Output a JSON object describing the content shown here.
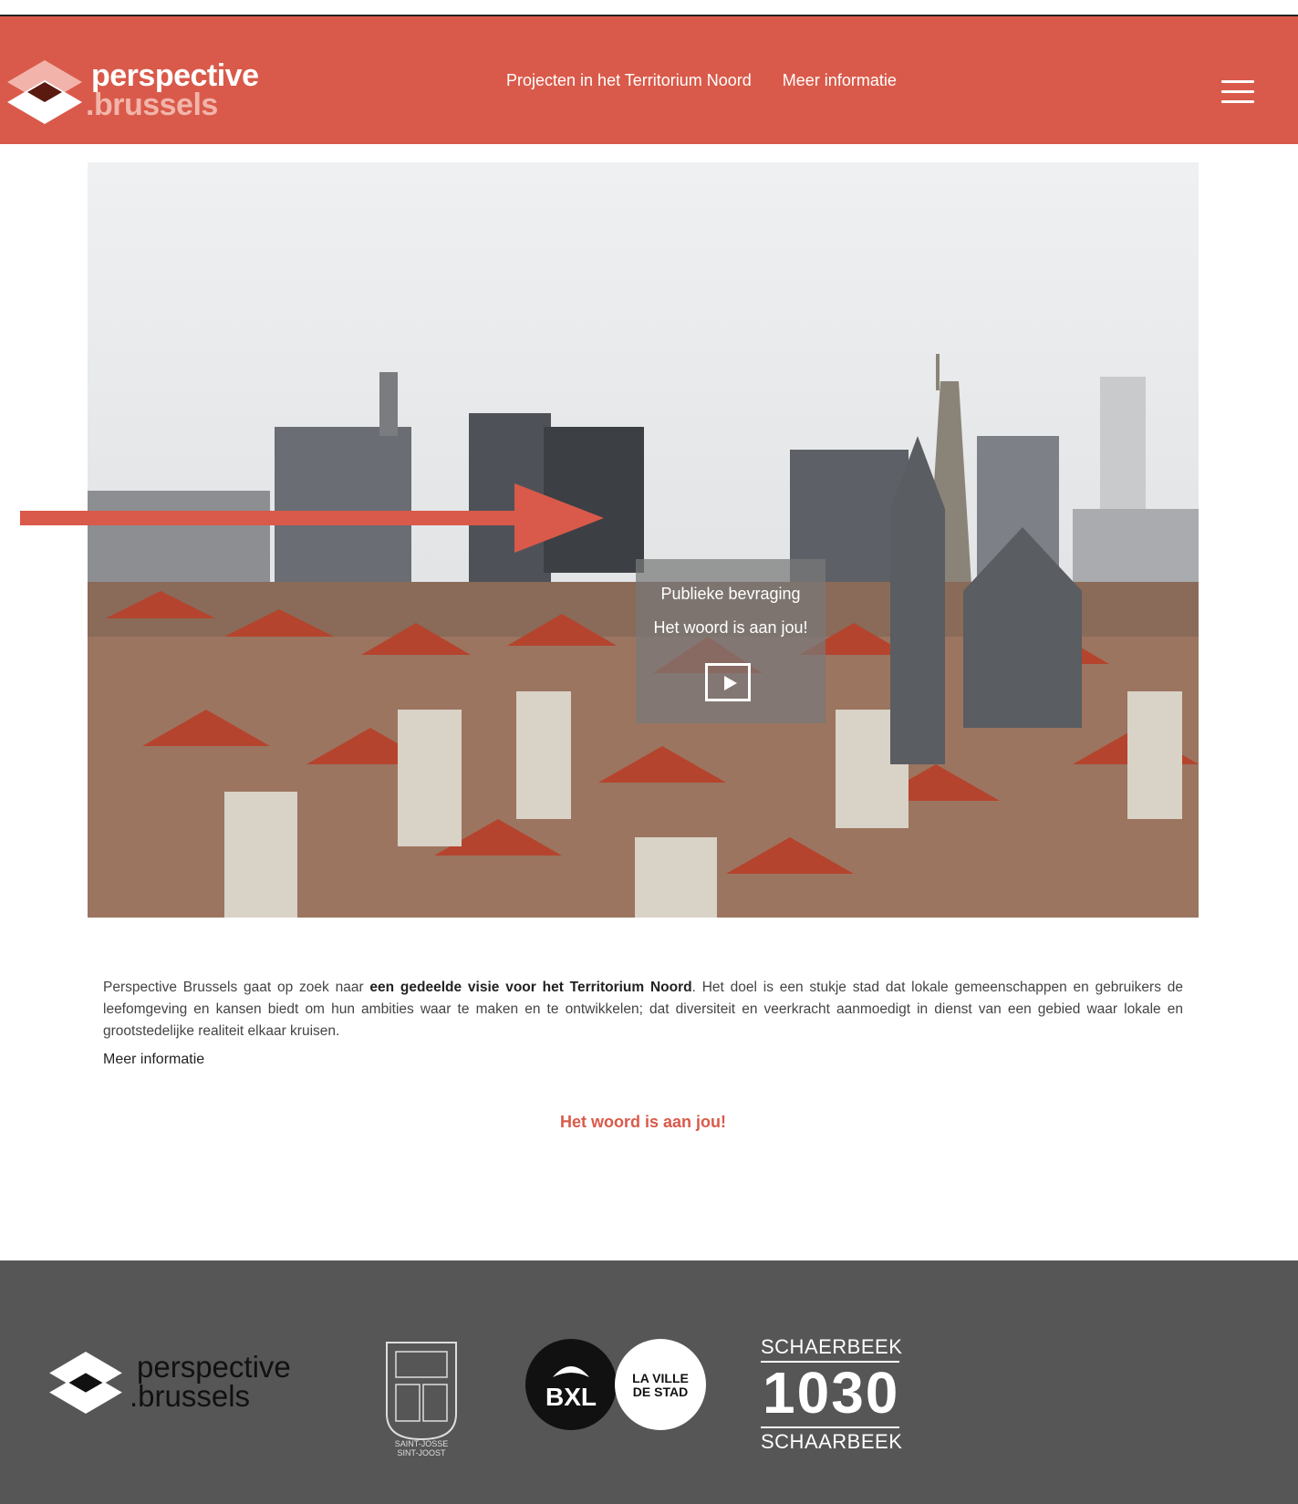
{
  "header": {
    "logo": {
      "line1": "perspective",
      "line2": ".brussels"
    },
    "nav": [
      {
        "label": "Projecten in het Territorium Noord"
      },
      {
        "label": "Meer informatie"
      }
    ],
    "menu_icon": "hamburger-icon"
  },
  "hero": {
    "overlay_line1": "Publieke bevraging",
    "overlay_line2": "Het woord is aan jou!",
    "play_icon": "play-icon"
  },
  "intro": {
    "text_before": "Perspective Brussels gaat op zoek naar ",
    "text_bold": "een gedeelde visie voor het Territorium Noord",
    "text_after": ". Het doel is een stukje stad dat lokale gemeenschappen en gebruikers de leefomgeving en kansen biedt om hun ambities waar te maken en te ontwikkelen; dat diversiteit en veerkracht aanmoedigt in dienst van een gebied waar lokale en grootstedelijke realiteit elkaar kruisen.",
    "more_link": "Meer informatie"
  },
  "cta": "Het woord is aan jou!",
  "footer": {
    "perspective_line1": "perspective",
    "perspective_line2": ".brussels",
    "shield_label_1": "SAINT-JOSSE",
    "shield_label_2": "SINT-JOOST",
    "bxl": "BXL",
    "ville_1": "LA VILLE",
    "ville_2": "DE STAD",
    "schaerbeek_top": "SCHAERBEEK",
    "schaerbeek_num": "1030",
    "schaerbeek_bottom": "SCHAARBEEK"
  },
  "colors": {
    "brand": "#d95a4a",
    "footer": "#565656",
    "logo_accent": "#f2b4aa"
  }
}
